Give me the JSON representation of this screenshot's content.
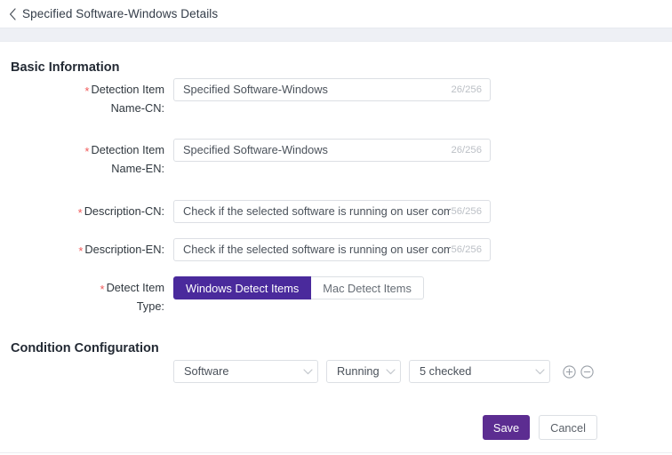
{
  "header": {
    "back_icon": "chevron-left-icon",
    "title": "Specified Software-Windows Details"
  },
  "sections": {
    "basic": {
      "title": "Basic Information"
    },
    "condition": {
      "title": "Condition Configuration"
    }
  },
  "fields": {
    "name_cn": {
      "label_line1": "Detection Item",
      "label_line2": "Name-CN:",
      "required_marker": "*",
      "value": "Specified Software-Windows",
      "placeholder": "Specified Software-Windows",
      "counter": "26/256"
    },
    "name_en": {
      "label_line1": "Detection Item",
      "label_line2": "Name-EN:",
      "required_marker": "*",
      "value": "Specified Software-Windows",
      "placeholder": "Specified Software-Windows",
      "counter": "26/256"
    },
    "desc_cn": {
      "label": "Description-CN:",
      "required_marker": "*",
      "value": "Check if the selected software is running on user computers.",
      "placeholder": "Check if the selected software is running on user computers.",
      "counter": "56/256"
    },
    "desc_en": {
      "label": "Description-EN:",
      "required_marker": "*",
      "value": "Check if the selected software is running on user computers.",
      "placeholder": "Check if the selected software is running on user computers.",
      "counter": "56/256"
    },
    "detect_item_type": {
      "label_line1": "Detect Item",
      "label_line2": "Type:",
      "required_marker": "*",
      "options": [
        {
          "label": "Windows Detect Items",
          "selected": true
        },
        {
          "label": "Mac Detect Items",
          "selected": false
        }
      ]
    }
  },
  "condition_row": {
    "subject": {
      "value": "Software",
      "chevron_icon": "chevron-down-icon"
    },
    "state": {
      "value": "Running",
      "chevron_icon": "chevron-down-icon"
    },
    "targets": {
      "value": "5 checked",
      "chevron_icon": "chevron-down-icon"
    },
    "add_icon": "plus-circle-icon",
    "remove_icon": "minus-circle-icon"
  },
  "footer": {
    "save_label": "Save",
    "cancel_label": "Cancel"
  },
  "colors": {
    "accent_purple": "#5c2d91",
    "toggle_active": "#4a2a9c",
    "required_red": "#f05a5a",
    "band_gray": "#eef0f5",
    "border_gray": "#dcdfe4",
    "counter_gray": "#bcc0c6"
  }
}
